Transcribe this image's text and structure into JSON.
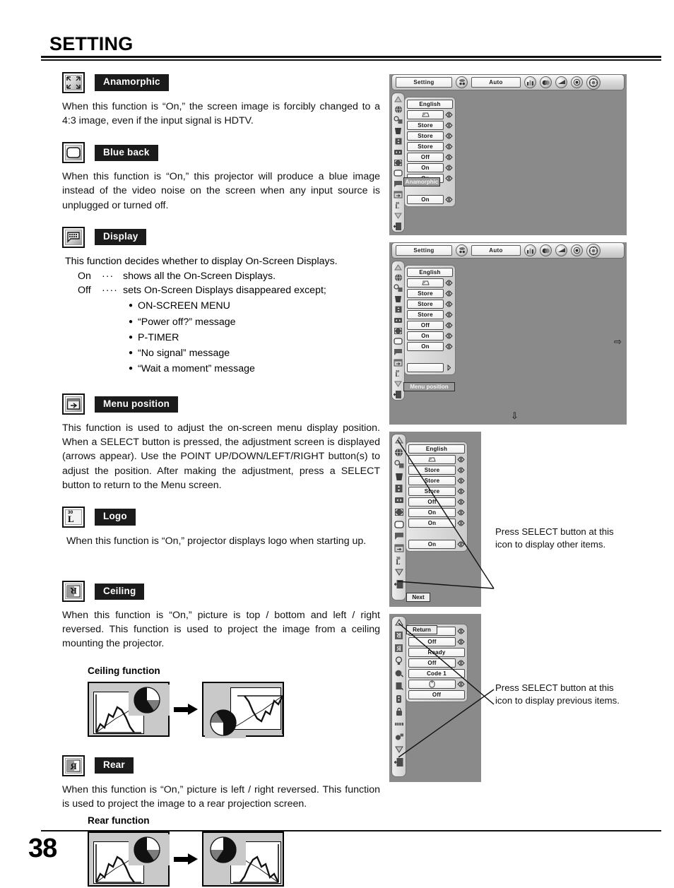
{
  "page": {
    "header_title": "SETTING",
    "page_number": "38"
  },
  "sections": [
    {
      "id": "anamorphic",
      "label": "Anamorphic",
      "icon": "anamorphic-icon",
      "body": "When this function is “On,” the screen image is forcibly changed to a 4:3 image, even if the input signal is HDTV."
    },
    {
      "id": "blue-back",
      "label": "Blue back",
      "icon": "blue-back-icon",
      "body": "When this function is “On,” this projector will produce a blue image instead of the video noise on the screen when any input source is unplugged or turned off."
    },
    {
      "id": "display",
      "label": "Display",
      "icon": "display-icon",
      "body": "This function decides whether to display On-Screen Displays.",
      "on_term": "On",
      "on_dots": "···",
      "on_text": "shows all the On-Screen Displays.",
      "off_term": "Off",
      "off_dots": "····",
      "off_text": "sets On-Screen Displays disappeared except;",
      "bullets": [
        "ON-SCREEN MENU",
        "“Power off?” message",
        "P-TIMER",
        "“No signal” message",
        "“Wait a moment” message"
      ]
    },
    {
      "id": "menu-position",
      "label": "Menu position",
      "icon": "menu-position-icon",
      "body": "This function is used to adjust the on-screen menu display position. When a SELECT button is pressed, the adjustment screen is displayed (arrows appear). Use the POINT UP/DOWN/LEFT/RIGHT button(s) to adjust the position. After making the adjustment, press a SELECT button to return to the Menu screen."
    },
    {
      "id": "logo",
      "label": "Logo",
      "icon": "logo-icon",
      "icon_text": "30",
      "icon_glyph": "L",
      "body": "When this function is “On,” projector displays logo when starting up."
    },
    {
      "id": "ceiling",
      "label": "Ceiling",
      "icon": "ceiling-icon",
      "body": "When this function is “On,” picture is top / bottom and left / right reversed.  This function is used to project the image from a ceiling mounting the projector.",
      "figure_title": "Ceiling function"
    },
    {
      "id": "rear",
      "label": "Rear",
      "icon": "rear-icon",
      "body": "When this function is “On,” picture is left / right reversed.  This function is used to project the image to a rear projection screen.",
      "figure_title": "Rear function"
    }
  ],
  "osd_panels": [
    {
      "id": "panel-anamorphic",
      "menu_button": "Setting",
      "auto_button": "Auto",
      "rows": [
        {
          "value": "English",
          "has_arrows": false
        },
        {
          "value": "",
          "has_arrows": true,
          "glyph": "keystone-icon"
        },
        {
          "value": "Store",
          "has_arrows": true
        },
        {
          "value": "Store",
          "has_arrows": true
        },
        {
          "value": "Store",
          "has_arrows": true
        },
        {
          "value": "Off",
          "has_arrows": true
        },
        {
          "value": "On",
          "has_arrows": true,
          "highlight": "Anamorphic"
        },
        {
          "value": "On",
          "has_arrows": true
        },
        {
          "value": "",
          "has_arrows": false
        },
        {
          "value": "On",
          "has_arrows": true
        }
      ]
    },
    {
      "id": "panel-menu-position",
      "menu_button": "Setting",
      "auto_button": "Auto",
      "rows": [
        {
          "value": "English",
          "has_arrows": false
        },
        {
          "value": "",
          "has_arrows": true,
          "glyph": "keystone-icon"
        },
        {
          "value": "Store",
          "has_arrows": true
        },
        {
          "value": "Store",
          "has_arrows": true
        },
        {
          "value": "Store",
          "has_arrows": true
        },
        {
          "value": "Off",
          "has_arrows": true
        },
        {
          "value": "On",
          "has_arrows": true
        },
        {
          "value": "On",
          "has_arrows": true
        },
        {
          "value": "",
          "has_arrows": false
        },
        {
          "value": "",
          "has_arrows": true,
          "highlight": "Menu position"
        }
      ],
      "adjust_arrow_right": "⇨",
      "adjust_arrow_down": "⇩"
    },
    {
      "id": "panel-next",
      "rows": [
        {
          "value": "English",
          "has_arrows": false
        },
        {
          "value": "",
          "has_arrows": true,
          "glyph": "keystone-icon"
        },
        {
          "value": "Store",
          "has_arrows": true
        },
        {
          "value": "Store",
          "has_arrows": true
        },
        {
          "value": "Store",
          "has_arrows": true
        },
        {
          "value": "Off",
          "has_arrows": true
        },
        {
          "value": "On",
          "has_arrows": true
        },
        {
          "value": "On",
          "has_arrows": true
        },
        {
          "value": "",
          "has_arrows": false
        },
        {
          "value": "On",
          "has_arrows": true
        }
      ],
      "tooltip": "Next",
      "note": "Press SELECT button at this icon to display other items."
    },
    {
      "id": "panel-return",
      "rows": [
        {
          "value": "",
          "has_arrows": true,
          "highlight": "Return"
        },
        {
          "value": "Off",
          "has_arrows": true
        },
        {
          "value": "Ready",
          "has_arrows": false
        },
        {
          "value": "Off",
          "has_arrows": true
        },
        {
          "value": "Code 1",
          "has_arrows": false
        },
        {
          "value": "",
          "has_arrows": true,
          "glyph": "mouse-icon"
        },
        {
          "value": "Off",
          "has_arrows": false
        }
      ],
      "note": "Press SELECT button at this icon to display previous items."
    }
  ]
}
